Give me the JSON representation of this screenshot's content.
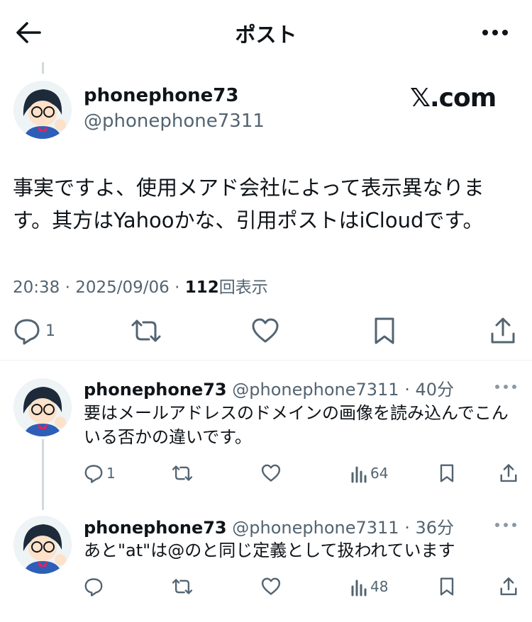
{
  "header": {
    "title": "ポスト"
  },
  "main_post": {
    "display_name": "phonephone73",
    "handle": "@phonephone7311",
    "brand_mark": "𝕏.com",
    "text": "事実ですよ、使用メアド会社によって表示異なります。其方はYahooかな、引用ポストはiCloudです。",
    "time": "20:38",
    "date": "2025/09/06",
    "separator": "·",
    "views_count": "112",
    "views_label": "回表示",
    "reply_count": "1"
  },
  "replies": [
    {
      "display_name": "phonephone73",
      "handle": "@phonephone7311",
      "age": "· 40分",
      "text": "要はメールアドレスのドメインの画像を読み込んでこんいる否かの違いです。",
      "reply_count": "1",
      "views": "64"
    },
    {
      "display_name": "phonephone73",
      "handle": "@phonephone7311",
      "age": "· 36分",
      "text": "あと\"at\"は@のと同じ定義として扱われています",
      "reply_count": "",
      "views": "48"
    }
  ],
  "colors": {
    "text_primary": "#0f1419",
    "text_secondary": "#536471",
    "thread_line": "#cfd9de",
    "divider": "#eff3f4"
  }
}
